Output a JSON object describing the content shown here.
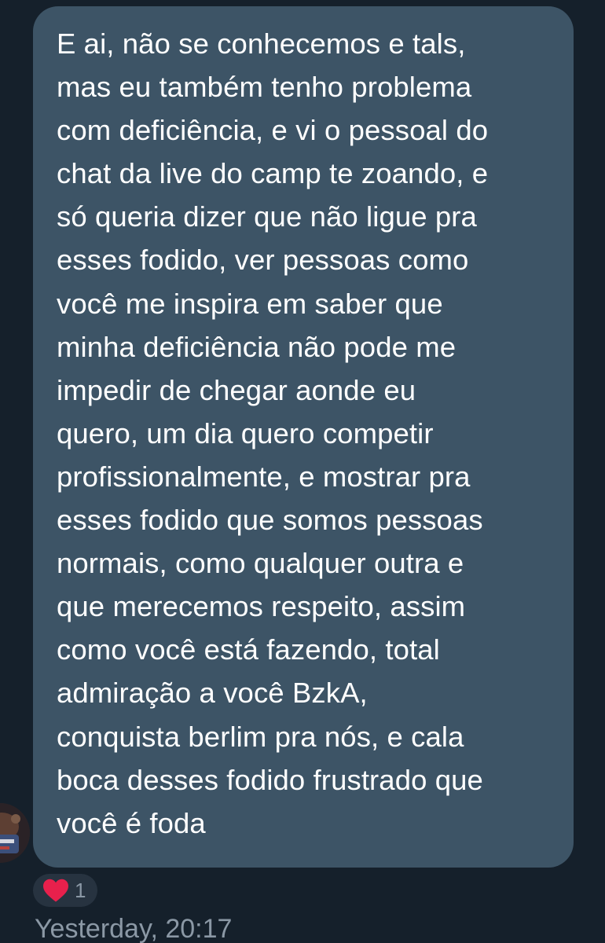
{
  "message": {
    "lines": [
      "E ai, não se conhecemos e tals,",
      "mas eu também tenho problema",
      "com deficiência, e vi o pessoal do",
      "chat da live do camp te zoando, e",
      "só queria dizer que não ligue pra",
      "esses fodido, ver pessoas como",
      "você me inspira em saber que",
      "minha deficiência não pode me",
      "impedir de chegar aonde eu",
      "quero, um dia quero competir",
      "profissionalmente, e mostrar pra",
      "esses fodido que somos pessoas",
      "normais, como qualquer outra e",
      "que merecemos respeito, assim",
      "como você está fazendo, total",
      "admiração a você BzkA,",
      "conquista berlim pra nós, e cala",
      "boca desses fodido frustrado que",
      "você é foda"
    ]
  },
  "reaction": {
    "icon": "heart-icon",
    "color": "#f91880",
    "count": "1"
  },
  "timestamp": "Yesterday, 20:17",
  "colors": {
    "background": "#15202b",
    "bubble": "#3d5466",
    "text": "#ffffff",
    "muted": "#8b98a5"
  }
}
